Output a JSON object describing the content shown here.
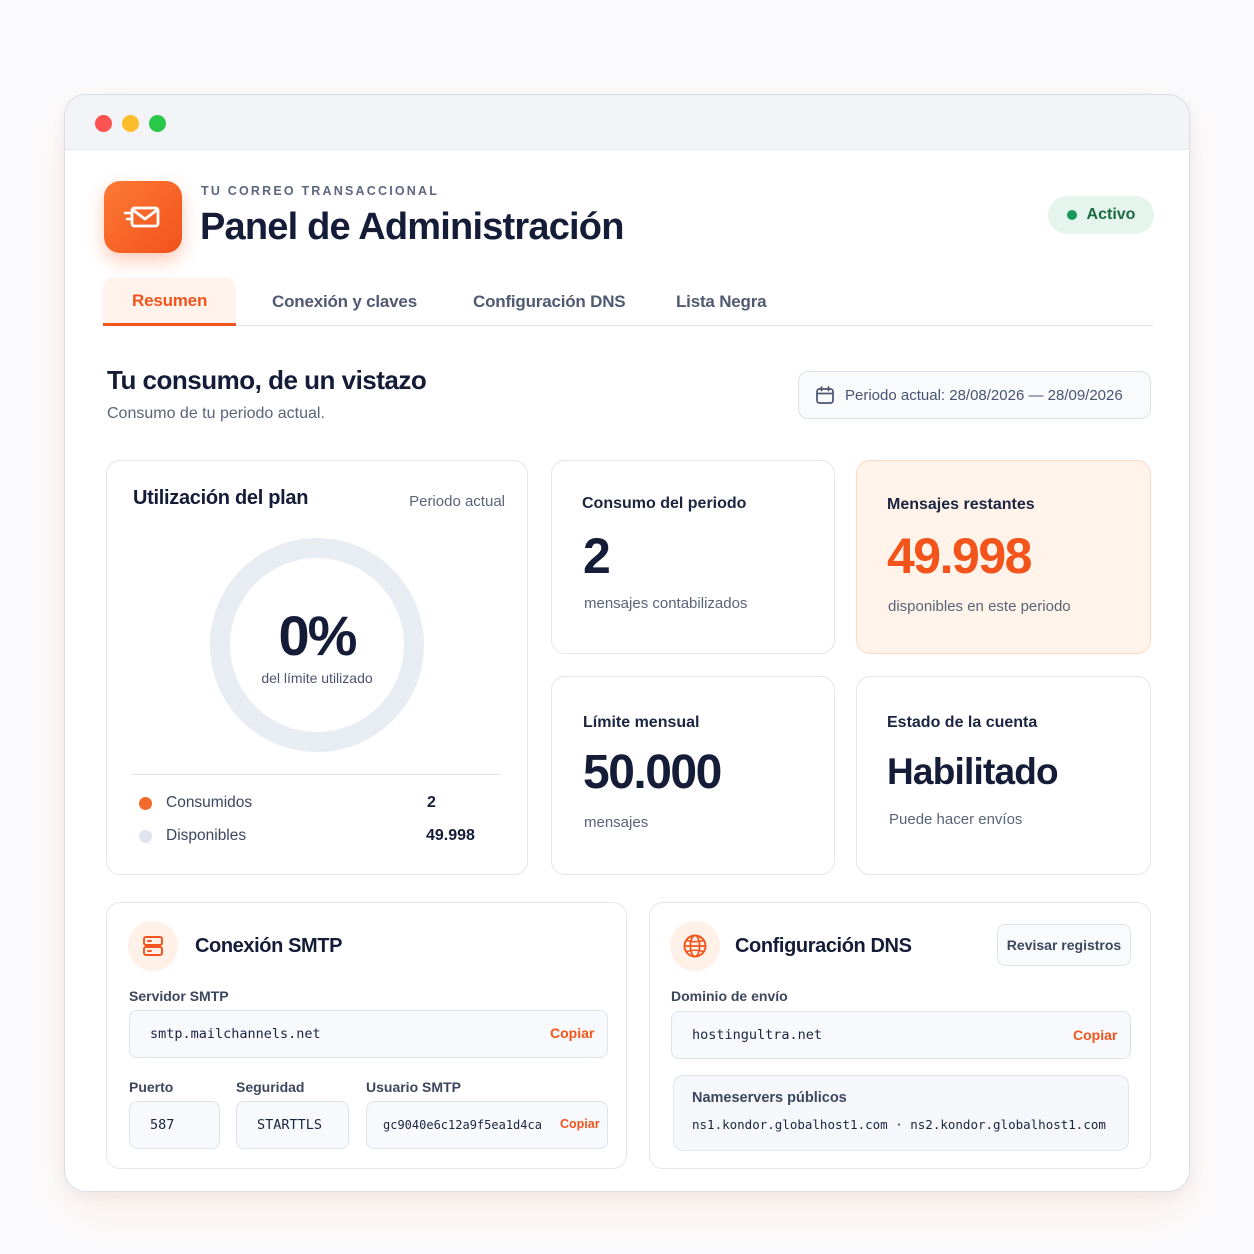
{
  "header": {
    "eyebrow": "TU CORREO TRANSACCIONAL",
    "title": "Panel de Administración",
    "status": "Activo"
  },
  "tabs": [
    {
      "label": "Resumen",
      "active": true
    },
    {
      "label": "Conexión y claves",
      "active": false
    },
    {
      "label": "Configuración DNS",
      "active": false
    },
    {
      "label": "Lista Negra",
      "active": false
    }
  ],
  "overview": {
    "title": "Tu consumo, de un vistazo",
    "subtitle": "Consumo de tu periodo actual.",
    "period": "Periodo actual: 28/08/2026 — 28/09/2026"
  },
  "usage": {
    "title": "Utilización del plan",
    "period_label": "Periodo actual",
    "percent": "0%",
    "percent_caption": "del límite utilizado",
    "fraction_used": 4e-05,
    "legend": [
      {
        "label": "Consumidos",
        "value": "2",
        "color": "#f26a2e"
      },
      {
        "label": "Disponibles",
        "value": "49.998",
        "color": "#dfe4ee"
      }
    ]
  },
  "stats": {
    "consumption": {
      "label": "Consumo del periodo",
      "value": "2",
      "caption": "mensajes contabilizados"
    },
    "remaining": {
      "label": "Mensajes restantes",
      "value": "49.998",
      "caption": "disponibles en este periodo"
    },
    "limit": {
      "label": "Límite mensual",
      "value": "50.000",
      "caption": "mensajes"
    },
    "account": {
      "label": "Estado de la cuenta",
      "value": "Habilitado",
      "caption": "Puede hacer envíos"
    }
  },
  "smtp": {
    "title": "Conexión SMTP",
    "server_label": "Servidor SMTP",
    "server": "smtp.mailchannels.net",
    "copy": "Copiar",
    "port_label": "Puerto",
    "port": "587",
    "security_label": "Seguridad",
    "security": "STARTTLS",
    "user_label": "Usuario SMTP",
    "user": "gc9040e6c12a9f5ea1d4ca"
  },
  "dns": {
    "title": "Configuración DNS",
    "review": "Revisar registros",
    "domain_label": "Dominio de envío",
    "domain": "hostingultra.net",
    "copy": "Copiar",
    "ns_label": "Nameservers públicos",
    "nameservers": "ns1.kondor.globalhost1.com  ·  ns2.kondor.globalhost1.com"
  },
  "colors": {
    "accent": "#f2541b",
    "status": "#169a5a",
    "remaining_bg": "#fff3ea"
  },
  "icons": [
    "envelope-icon",
    "calendar-icon",
    "server-icon",
    "globe-icon"
  ]
}
